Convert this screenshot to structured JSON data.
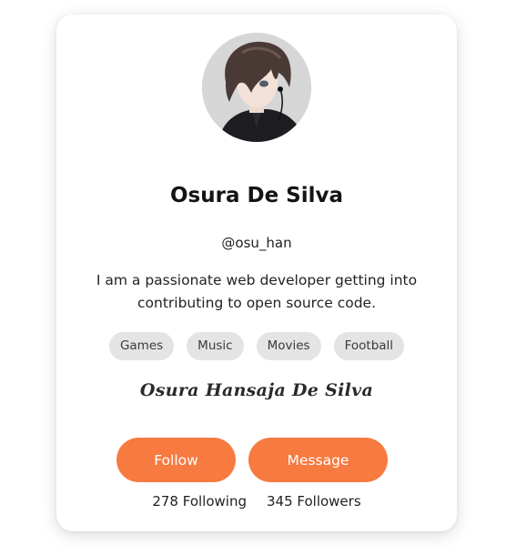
{
  "profile": {
    "avatar_icon": "anime-boy-portrait",
    "name": "Osura De Silva",
    "handle": "@osu_han",
    "bio": "I am a passionate web developer getting into contributing to open source code.",
    "signature": "Osura Hansaja De Silva"
  },
  "tags": [
    "Games",
    "Music",
    "Movies",
    "Football"
  ],
  "actions": {
    "follow_label": "Follow",
    "message_label": "Message"
  },
  "stats": {
    "following": "278 Following",
    "followers": "345 Followers"
  },
  "colors": {
    "accent": "#f77a40",
    "tag_bg": "#e4e4e4",
    "card_bg": "#ffffff"
  }
}
